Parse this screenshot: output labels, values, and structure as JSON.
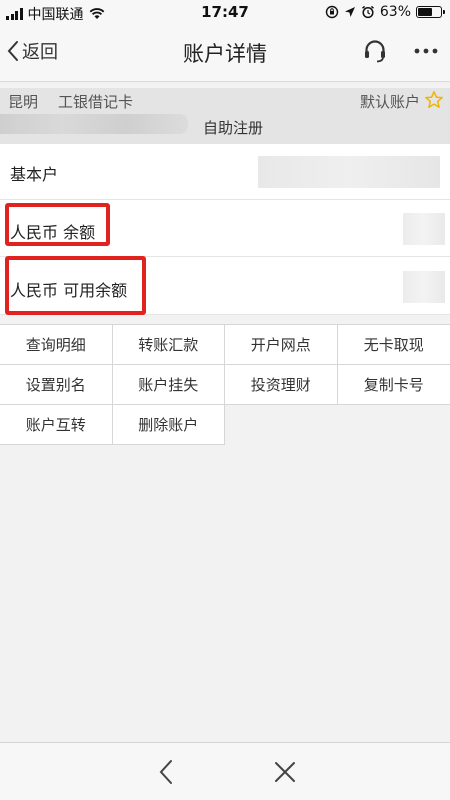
{
  "status_bar": {
    "carrier": "中国联通",
    "time": "17:47",
    "battery_percent": "63%",
    "battery_level": 0.63
  },
  "nav": {
    "back_label": "返回",
    "title": "账户详情",
    "support_icon": "headset-icon",
    "more_icon": "more-dots-icon"
  },
  "account": {
    "city": "昆明",
    "card_type": "工银借记卡",
    "default_label": "默认账户",
    "register_label": "自助注册"
  },
  "rows": [
    {
      "label": "基本户"
    },
    {
      "label": "人民币 余额"
    },
    {
      "label": "人民币 可用余额"
    }
  ],
  "actions": [
    "查询明细",
    "转账汇款",
    "开户网点",
    "无卡取现",
    "设置别名",
    "账户挂失",
    "投资理财",
    "复制卡号",
    "账户互转",
    "删除账户"
  ],
  "colors": {
    "highlight": "#e0231f",
    "star": "#f0b400"
  }
}
